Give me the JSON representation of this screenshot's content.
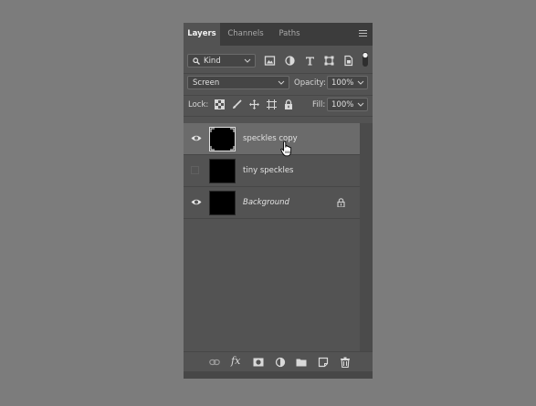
{
  "panel": {
    "tabs": [
      {
        "label": "Layers",
        "active": true
      },
      {
        "label": "Channels",
        "active": false
      },
      {
        "label": "Paths",
        "active": false
      }
    ],
    "menu_icon": "hamburger-menu-icon"
  },
  "filter": {
    "kind_label": "Kind",
    "icons": [
      "pixel-filter-icon",
      "adjustment-filter-icon",
      "type-filter-icon",
      "shape-filter-icon",
      "smart-object-filter-icon",
      "filter-toggle-icon"
    ]
  },
  "blend": {
    "mode": "Screen",
    "opacity_label": "Opacity:",
    "opacity_value": "100%"
  },
  "lock": {
    "label": "Lock:",
    "icons": [
      "lock-transparent-pixels-icon",
      "lock-image-pixels-icon",
      "lock-position-icon",
      "lock-artboard-icon",
      "lock-all-icon"
    ],
    "fill_label": "Fill:",
    "fill_value": "100%"
  },
  "layers": [
    {
      "name": "speckles copy",
      "visible": true,
      "selected": true,
      "italic": false,
      "locked": false
    },
    {
      "name": "tiny speckles",
      "visible": false,
      "selected": false,
      "italic": false,
      "locked": false
    },
    {
      "name": "Background",
      "visible": true,
      "selected": false,
      "italic": true,
      "locked": true
    }
  ],
  "footer": {
    "icons": [
      "link-layers-icon",
      "fx-icon",
      "add-mask-icon",
      "adjustment-layer-icon",
      "new-group-icon",
      "new-layer-icon",
      "delete-icon"
    ],
    "fx_label": "fx"
  },
  "colors": {
    "background": "#7c7c7c",
    "panel": "#535353",
    "tabbar": "#3c3c3c",
    "selected_row": "#6b6b6b"
  }
}
